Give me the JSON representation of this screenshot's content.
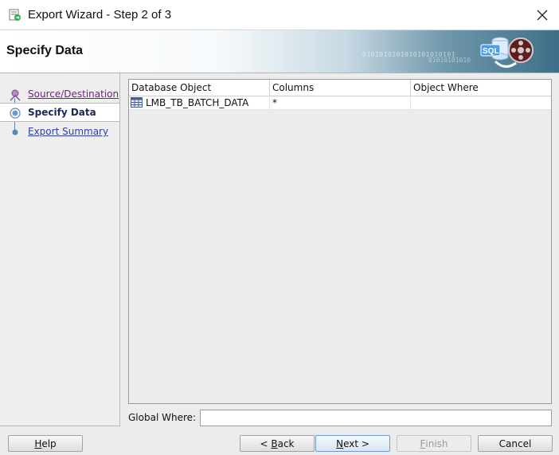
{
  "window": {
    "title": "Export Wizard - Step 2 of 3",
    "close_glyph": "✕"
  },
  "banner": {
    "heading": "Specify Data",
    "binary_text_1": "0101010101010101010101",
    "binary_text_2": "01010101010",
    "logo_text": "SQL"
  },
  "nav": {
    "steps": [
      {
        "label": "Source/Destination",
        "state": "visited"
      },
      {
        "label": "Specify Data",
        "state": "current"
      },
      {
        "label": "Export Summary",
        "state": "pending"
      }
    ]
  },
  "table": {
    "columns": [
      "Database Object",
      "Columns",
      "Object Where"
    ],
    "rows": [
      {
        "object": "LMB_TB_BATCH_DATA",
        "columns": "*",
        "where": ""
      }
    ]
  },
  "global_where": {
    "label": "Global Where:",
    "value": ""
  },
  "buttons": {
    "help": {
      "pre": "",
      "mnemonic": "H",
      "post": "elp"
    },
    "back": {
      "pre": "< ",
      "mnemonic": "B",
      "post": "ack"
    },
    "next": {
      "pre": "",
      "mnemonic": "N",
      "post": "ext >"
    },
    "finish": {
      "pre": "",
      "mnemonic": "F",
      "post": "inish"
    },
    "cancel": {
      "pre": "Cancel",
      "mnemonic": "",
      "post": ""
    }
  },
  "colors": {
    "link": "#2b3fa8",
    "visited_link": "#7a1b8a",
    "rail": "#5a86b8",
    "primary_border": "#6f9bd1"
  },
  "icons": {
    "app": "export-wizard-icon",
    "close": "close-icon",
    "banner": "sql-export-graphic",
    "table_object": "table-icon"
  }
}
